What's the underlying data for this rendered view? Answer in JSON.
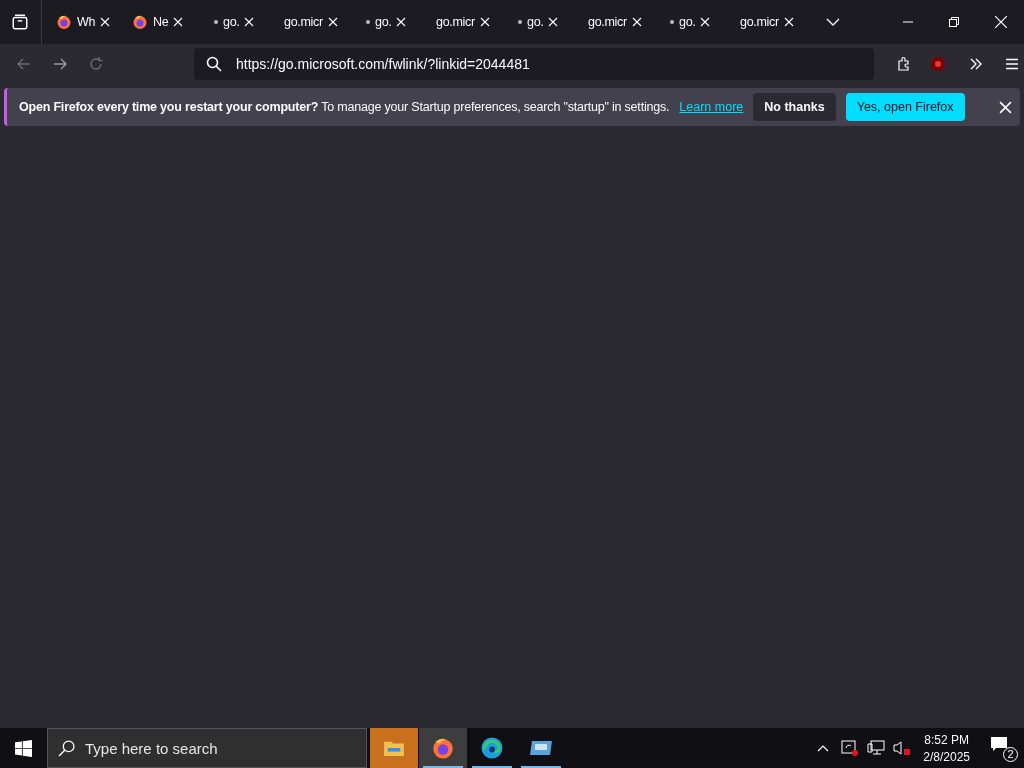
{
  "tabs": [
    {
      "label": "Wh",
      "kind": "firefox"
    },
    {
      "label": "Ne",
      "kind": "firefox"
    },
    {
      "label": "go.",
      "kind": "dot"
    },
    {
      "label": "go.micr",
      "kind": "plain"
    },
    {
      "label": "go.",
      "kind": "dot"
    },
    {
      "label": "go.micr",
      "kind": "plain"
    },
    {
      "label": "go.",
      "kind": "dot"
    },
    {
      "label": "go.micr",
      "kind": "plain"
    },
    {
      "label": "go.",
      "kind": "dot"
    },
    {
      "label": "go.micr",
      "kind": "plain"
    }
  ],
  "address_bar": {
    "value": "https://go.microsoft.com/fwlink/?linkid=2044481"
  },
  "nav": {
    "back_disabled": true,
    "forward_disabled": false
  },
  "notification": {
    "message": "**Open Firefox every time you restart your computer?** To manage your Startup preferences, search \"startup\" in settings.",
    "link": "Learn more",
    "buttons": [
      {
        "label": "No thanks",
        "kind": "secondary"
      },
      {
        "label": "Yes, open Firefox",
        "kind": "primary"
      }
    ]
  },
  "taskbar": {
    "search": {
      "placeholder": "Type here to search"
    },
    "apps": [
      {
        "kind": "folder",
        "flashing": true,
        "selected": false
      },
      {
        "kind": "firefox",
        "flashing": false,
        "selected": true
      },
      {
        "kind": "edge",
        "flashing": false,
        "selected": false
      },
      {
        "kind": "window",
        "flashing": false,
        "selected": false
      }
    ],
    "time": "8:52 PM",
    "date": "2/8/2025",
    "notifications": "2"
  }
}
